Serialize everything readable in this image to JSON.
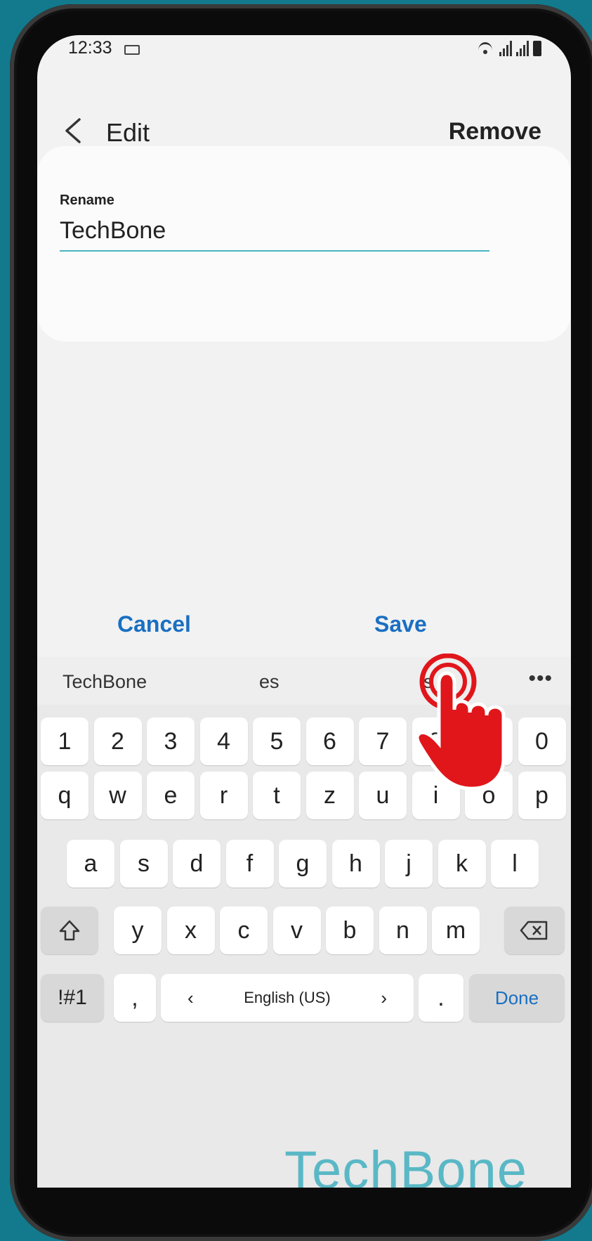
{
  "status_bar": {
    "time": "12:33"
  },
  "header": {
    "title": "Edit",
    "remove_label": "Remove"
  },
  "form": {
    "rename_label": "Rename",
    "rename_value": "TechBone"
  },
  "actions": {
    "cancel_label": "Cancel",
    "save_label": "Save"
  },
  "keyboard": {
    "suggestions": [
      "TechBone",
      "es",
      "is"
    ],
    "more": "•••",
    "row_numbers": [
      "1",
      "2",
      "3",
      "4",
      "5",
      "6",
      "7",
      "8",
      "9",
      "0"
    ],
    "row_top": [
      "q",
      "w",
      "e",
      "r",
      "t",
      "z",
      "u",
      "i",
      "o",
      "p"
    ],
    "row_middle": [
      "a",
      "s",
      "d",
      "f",
      "g",
      "h",
      "j",
      "k",
      "l"
    ],
    "row_bottom": [
      "y",
      "x",
      "c",
      "v",
      "b",
      "n",
      "m"
    ],
    "symbols_label": "!#1",
    "comma_label": ",",
    "language_label": "English (US)",
    "period_label": ".",
    "done_label": "Done"
  },
  "watermark": "TechBone",
  "colors": {
    "accent": "#1a6fc2",
    "underline": "#4cb4c4",
    "background": "#127a8c",
    "hand": "#e0161b"
  }
}
